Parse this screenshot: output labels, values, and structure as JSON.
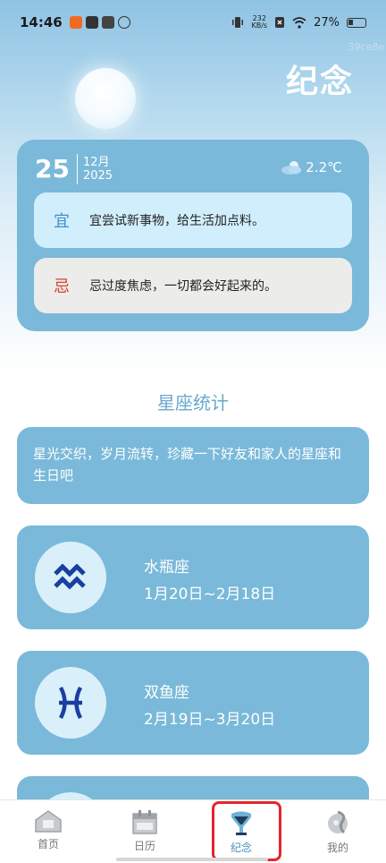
{
  "status_bar": {
    "time": "14:46",
    "net_speed_value": "232",
    "net_speed_unit": "KB/s",
    "battery": "27%"
  },
  "watermark": "39ce8e",
  "header": {
    "title": "纪念"
  },
  "date_card": {
    "day": "25",
    "month": "12月",
    "year": "2025",
    "weather_temp": "2.2℃",
    "yi_label": "宜",
    "yi_text": "宜尝试新事物，给生活加点料。",
    "ji_label": "忌",
    "ji_text": "忌过度焦虑，一切都会好起来的。"
  },
  "section": {
    "title": "星座统计",
    "intro": "星光交织，岁月流转，珍藏一下好友和家人的星座和生日吧"
  },
  "zodiacs": [
    {
      "name": "水瓶座",
      "range": "1月20日~2月18日",
      "icon": "aquarius-icon"
    },
    {
      "name": "双鱼座",
      "range": "2月19日~3月20日",
      "icon": "pisces-icon"
    },
    {
      "name": "",
      "range": "",
      "icon": "zodiac-icon"
    }
  ],
  "nav": {
    "items": [
      {
        "label": "首页",
        "icon": "home-icon"
      },
      {
        "label": "日历",
        "icon": "calendar-icon"
      },
      {
        "label": "纪念",
        "icon": "memorial-icon"
      },
      {
        "label": "我的",
        "icon": "profile-icon"
      }
    ]
  },
  "colors": {
    "accent": "#7ab9d9",
    "active_nav": "#4b8eb9",
    "highlight": "#e3262b"
  }
}
